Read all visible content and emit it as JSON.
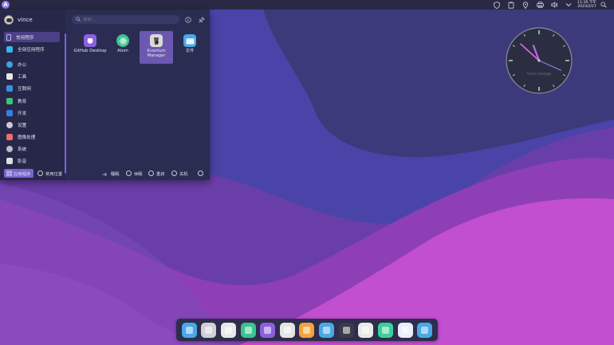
{
  "topbar": {
    "launcher_glyph": "A",
    "tray_icons": [
      "shield-icon",
      "clipboard-icon",
      "location-icon",
      "printer-icon",
      "volume-icon",
      "chevron-down-icon",
      "search-icon"
    ],
    "time": "11:19 下午",
    "date": "2023/2/27"
  },
  "menu": {
    "username": "vince",
    "search_placeholder": "搜索...",
    "categories": [
      {
        "label": "常用程序",
        "color": "#8b7cf6",
        "selected": true
      },
      {
        "label": "全部应用程序",
        "color": "#37b7e8"
      },
      {
        "label": "办公",
        "color": "#3aa6e8"
      },
      {
        "label": "工具",
        "color": "#e8e8e8"
      },
      {
        "label": "互联网",
        "color": "#3b8fe0"
      },
      {
        "label": "教育",
        "color": "#3cc37a"
      },
      {
        "label": "开发",
        "color": "#3a7be0"
      },
      {
        "label": "设置",
        "color": "#c8c8d8"
      },
      {
        "label": "图像处理",
        "color": "#ef6b6b"
      },
      {
        "label": "系统",
        "color": "#bdbdd0"
      },
      {
        "label": "影音",
        "color": "#e0dede"
      }
    ],
    "apps": [
      {
        "label": "GitHub Desktop",
        "color": "#8d5ee0"
      },
      {
        "label": "Atom",
        "color": "#3cc38f"
      },
      {
        "label": "Kvantum Manager",
        "color": "#d9d9d9",
        "selected": true
      },
      {
        "label": "文件",
        "color": "#4aa8e8"
      }
    ],
    "bottom": {
      "apps_tab": "应用程序",
      "places_tab": "常用位置",
      "sleep": "睡眠",
      "hibernate": "休眠",
      "restart": "重启",
      "shutdown": "关机"
    }
  },
  "clock_widget": {
    "brand": "Vince Design",
    "hour": 11,
    "minute": 19,
    "second": 52
  },
  "dock": {
    "items": [
      {
        "name": "files-icon",
        "color": "#4aa8e8"
      },
      {
        "name": "settings-icon",
        "color": "#d0d0d8"
      },
      {
        "name": "chrome-icon",
        "color": "#e8e8e8"
      },
      {
        "name": "atom-icon",
        "color": "#3cc38f"
      },
      {
        "name": "github-icon",
        "color": "#8d5ee0"
      },
      {
        "name": "kvantum-icon",
        "color": "#e4e4e4"
      },
      {
        "name": "photo-icon",
        "color": "#f3a23d"
      },
      {
        "name": "folder-icon",
        "color": "#4aa8e8"
      },
      {
        "name": "figma-icon",
        "color": "#3a3a48"
      },
      {
        "name": "inkscape-icon",
        "color": "#e9e9e9"
      },
      {
        "name": "music-icon",
        "color": "#3ccf9a"
      },
      {
        "name": "browser-icon",
        "color": "#e9eef8"
      },
      {
        "name": "file-manager-icon",
        "color": "#4aa8e8"
      }
    ]
  }
}
